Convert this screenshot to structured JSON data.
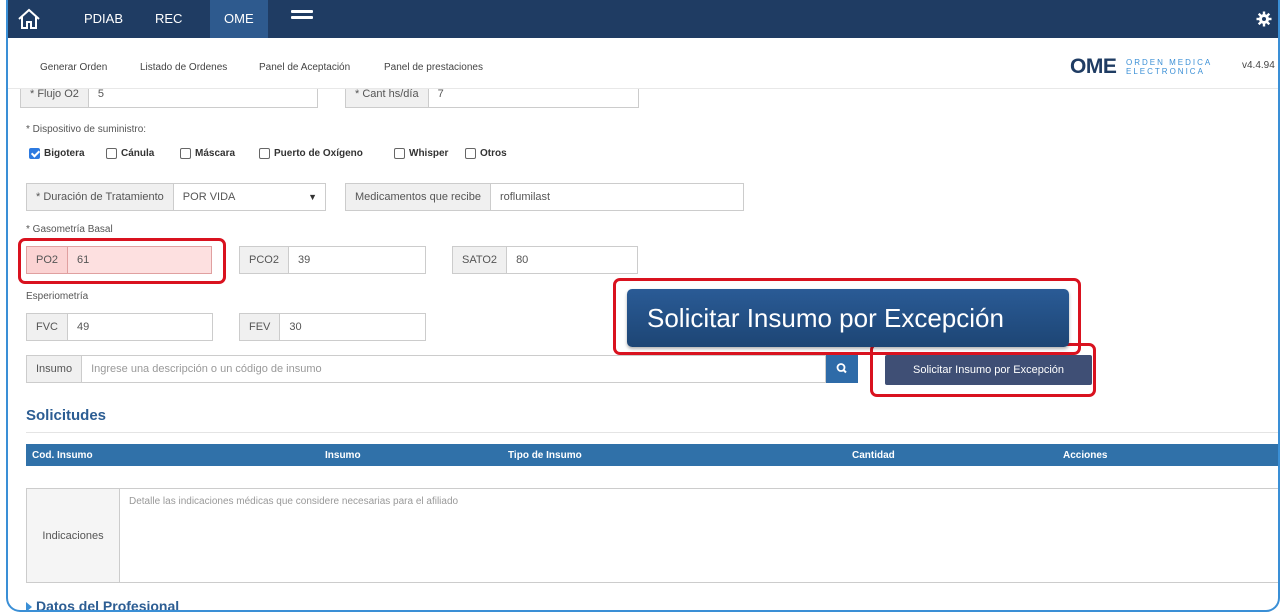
{
  "navbar": {
    "items": [
      {
        "label": "PDIAB"
      },
      {
        "label": "REC"
      },
      {
        "label": "OME"
      }
    ]
  },
  "submenu": {
    "items": [
      {
        "label": "Generar Orden"
      },
      {
        "label": "Listado de Ordenes"
      },
      {
        "label": "Panel de Aceptación"
      },
      {
        "label": "Panel de prestaciones"
      }
    ],
    "logo_big": "OME",
    "logo_small_1": "ORDEN MEDICA",
    "logo_small_2": "ELECTRONICA",
    "version": "v4.4.94"
  },
  "form": {
    "flujo": {
      "label": "* Flujo O2",
      "value": "5"
    },
    "cant": {
      "label": "* Cant hs/día",
      "value": "7"
    },
    "dispositivo_label": "* Dispositivo de suministro:",
    "dispositivos": [
      {
        "label": "Bigotera",
        "checked": true
      },
      {
        "label": "Cánula",
        "checked": false
      },
      {
        "label": "Máscara",
        "checked": false
      },
      {
        "label": "Puerto de Oxígeno",
        "checked": false
      },
      {
        "label": "Whisper",
        "checked": false
      },
      {
        "label": "Otros",
        "checked": false
      }
    ],
    "duracion": {
      "label": "* Duración de Tratamiento",
      "value": "POR VIDA"
    },
    "medicamentos": {
      "label": "Medicamentos que recibe",
      "value": "roflumilast"
    },
    "gasometria_label": "* Gasometría Basal",
    "po2": {
      "label": "PO2",
      "value": "61"
    },
    "pco2": {
      "label": "PCO2",
      "value": "39"
    },
    "sato2": {
      "label": "SATO2",
      "value": "80"
    },
    "esperiometria_label": "Esperiometría",
    "fvc": {
      "label": "FVC",
      "value": "49"
    },
    "fev": {
      "label": "FEV",
      "value": "30"
    },
    "insumo": {
      "label": "Insumo",
      "placeholder": "Ingrese una descripción o un código de insumo"
    },
    "excepcion_button": "Solicitar Insumo por Excepción",
    "callout_text": "Solicitar Insumo por Excepción"
  },
  "solicitudes": {
    "title": "Solicitudes",
    "columns": [
      "Cod. Insumo",
      "Insumo",
      "Tipo de Insumo",
      "Cantidad",
      "Acciones"
    ]
  },
  "indicaciones": {
    "label": "Indicaciones",
    "placeholder": "Detalle las indicaciones médicas que considere necesarias para el afiliado"
  },
  "datos_profesional": "Datos del Profesional"
}
